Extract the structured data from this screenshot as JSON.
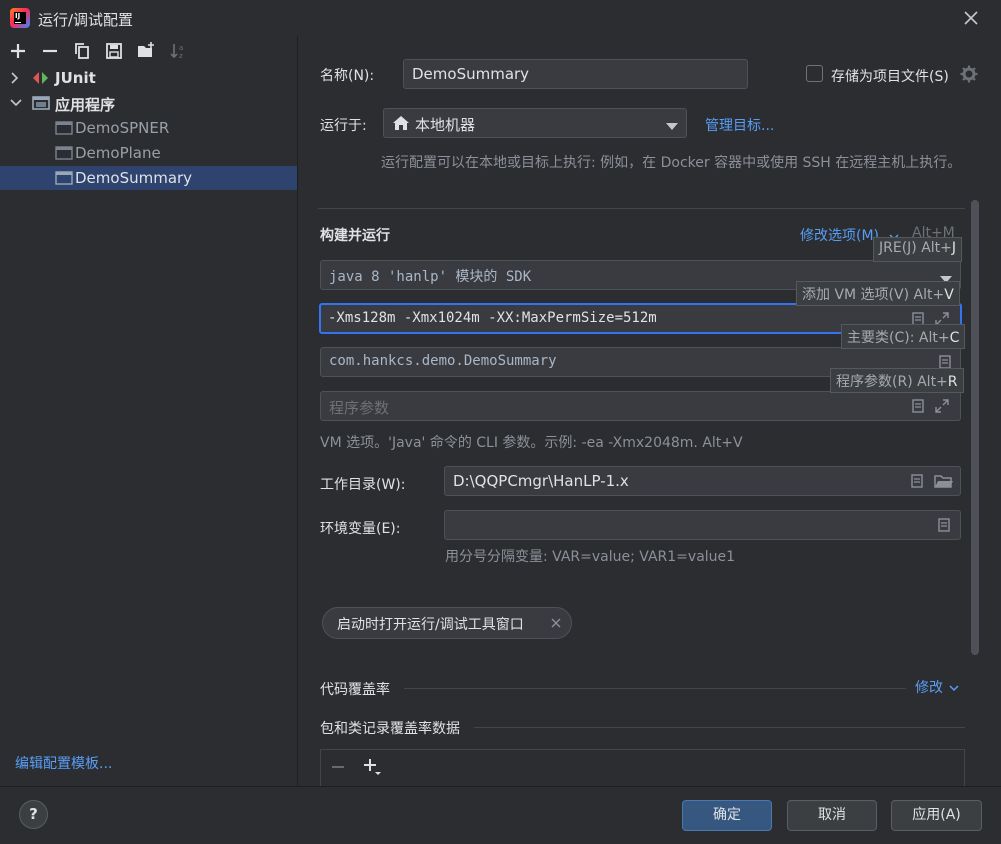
{
  "window": {
    "title": "运行/调试配置"
  },
  "left": {
    "tree": [
      {
        "label": "JUnit",
        "expanded": false,
        "bold": true
      },
      {
        "label": "应用程序",
        "expanded": true,
        "bold": true
      },
      {
        "label": "DemoSPNER"
      },
      {
        "label": "DemoPlane"
      },
      {
        "label": "DemoSummary",
        "selected": true
      }
    ],
    "edit_templates": "编辑配置模板..."
  },
  "form": {
    "name_label": "名称(N):",
    "name_value": "DemoSummary",
    "store_label": "存储为项目文件(S)",
    "runon_label": "运行于:",
    "runon_value": "本地机器",
    "manage_targets": "管理目标...",
    "runon_hint": "运行配置可以在本地或目标上执行: 例如，在 Docker 容器中或使用 SSH 在远程主机上执行。",
    "section_build": "构建并运行",
    "modify_options": "修改选项(M)",
    "modify_shortcut": "Alt+M",
    "jre_value": "java 8 'hanlp' 模块的 SDK",
    "vm_value": "-Xms128m -Xmx1024m -XX:MaxPermSize=512m",
    "main_class_value": "com.hankcs.demo.DemoSummary",
    "program_args_placeholder": "程序参数",
    "vm_hint": "VM 选项。'Java' 命令的 CLI 参数。示例: -ea -Xmx2048m. Alt+V",
    "workdir_label": "工作目录(W):",
    "workdir_value": "D:\\QQPCmgr\\HanLP-1.x",
    "env_label": "环境变量(E):",
    "env_hint": "用分号分隔变量: VAR=value; VAR1=value1",
    "chip_label": "启动时打开运行/调试工具窗口",
    "coverage_label": "代码覆盖率",
    "coverage_modify": "修改",
    "coverage_packages": "包和类记录覆盖率数据"
  },
  "tooltips": {
    "jre": {
      "text": "JRE(J) Alt+",
      "key": "J"
    },
    "vm": {
      "text": "添加 VM 选项(V) Alt+",
      "key": "V"
    },
    "main": {
      "text": "主要类(C): Alt+",
      "key": "C"
    },
    "args": {
      "text": "程序参数(R) Alt+",
      "key": "R"
    }
  },
  "buttons": {
    "ok": "确定",
    "cancel": "取消",
    "apply": "应用(A)",
    "help": "?"
  },
  "colors": {
    "accent": "#589df6",
    "selection": "#2e436e",
    "primary_button": "#365880",
    "focus": "#3574f0"
  }
}
